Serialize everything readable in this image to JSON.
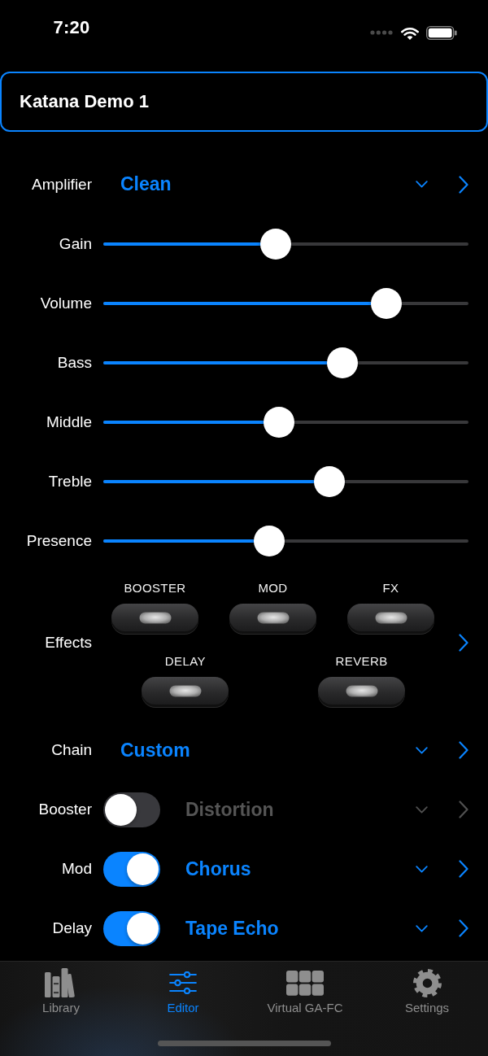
{
  "status_bar": {
    "time": "7:20"
  },
  "preset": {
    "name": "Katana Demo 1"
  },
  "amplifier": {
    "label": "Amplifier",
    "value": "Clean"
  },
  "knobs": [
    {
      "label": "Gain",
      "level": 0.47
    },
    {
      "label": "Volume",
      "level": 0.8
    },
    {
      "label": "Bass",
      "level": 0.67
    },
    {
      "label": "Middle",
      "level": 0.48
    },
    {
      "label": "Treble",
      "level": 0.63
    },
    {
      "label": "Presence",
      "level": 0.45
    }
  ],
  "effects": {
    "label": "Effects",
    "rows": [
      [
        {
          "label": "BOOSTER",
          "on": false
        },
        {
          "label": "MOD",
          "on": false
        },
        {
          "label": "FX",
          "on": false
        }
      ],
      [
        {
          "label": "DELAY",
          "on": false
        },
        {
          "label": "REVERB",
          "on": false
        }
      ]
    ]
  },
  "chain": {
    "label": "Chain",
    "value": "Custom"
  },
  "effect_rows": [
    {
      "label": "Booster",
      "on": false,
      "value": "Distortion"
    },
    {
      "label": "Mod",
      "on": true,
      "value": "Chorus"
    },
    {
      "label": "Delay",
      "on": true,
      "value": "Tape Echo"
    }
  ],
  "tab_bar": [
    {
      "kind": "library",
      "label": "Library",
      "selected": false
    },
    {
      "kind": "editor",
      "label": "Editor",
      "selected": true
    },
    {
      "kind": "grid",
      "label": "Virtual GA-FC",
      "selected": false
    },
    {
      "kind": "settings",
      "label": "Settings",
      "selected": false
    }
  ]
}
